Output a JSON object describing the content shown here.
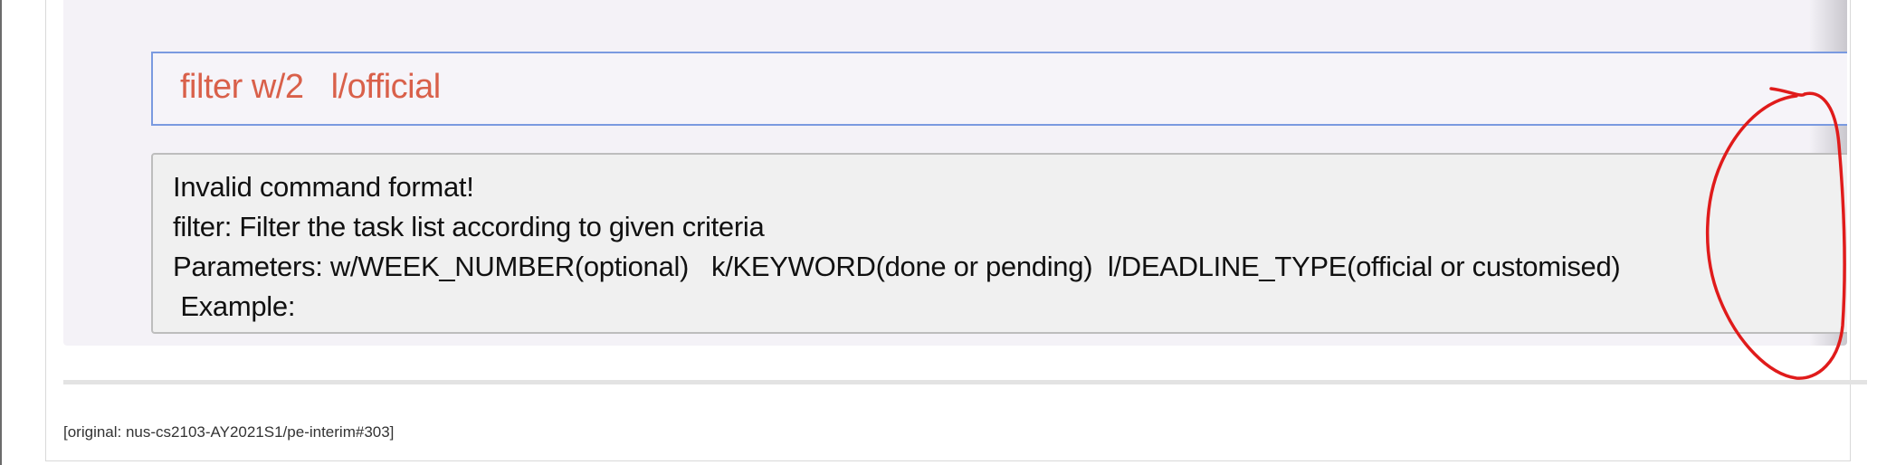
{
  "command_input": {
    "value": "filter w/2   l/official"
  },
  "result_display": {
    "lines": [
      "Invalid command format!",
      "filter: Filter the task list according to given criteria",
      "Parameters: w/WEEK_NUMBER(optional)   k/KEYWORD(done or pending)  l/DEADLINE_TYPE(official or customised)",
      " Example:"
    ]
  },
  "footer": {
    "note": "[original: nus-cs2103-AY2021S1/pe-interim#303]"
  },
  "colors": {
    "command_text": "#d9604a",
    "command_border": "#7a9ae0",
    "annotation_stroke": "#e01b1b"
  }
}
